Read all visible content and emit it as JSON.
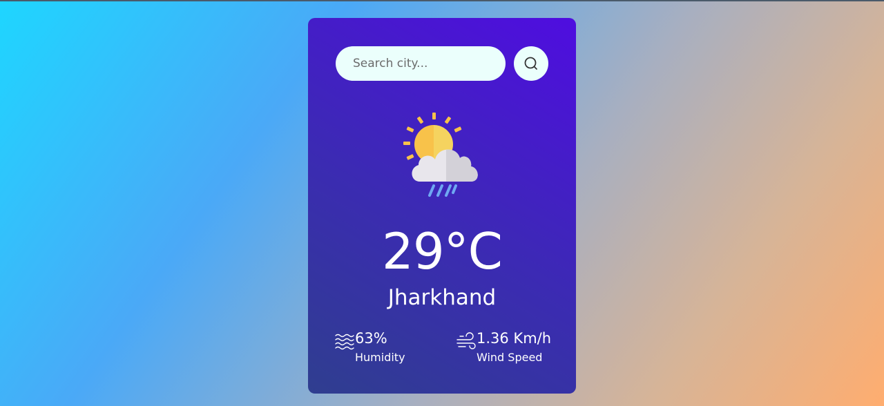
{
  "search": {
    "placeholder": "Search city...",
    "button_icon": "search-icon"
  },
  "weather": {
    "icon": "partly-cloudy-rain-icon",
    "temperature": "29°C",
    "city": "Jharkhand"
  },
  "details": {
    "humidity": {
      "icon": "humidity-icon",
      "value": "63%",
      "label": "Humidity"
    },
    "wind": {
      "icon": "wind-icon",
      "value": "1.36 Km/h",
      "label": "Wind Speed"
    }
  },
  "colors": {
    "card_gradient_start": "#2f3e8f",
    "card_gradient_end": "#4f0de0",
    "input_background": "#ebfffc",
    "text": "#ffffff"
  }
}
